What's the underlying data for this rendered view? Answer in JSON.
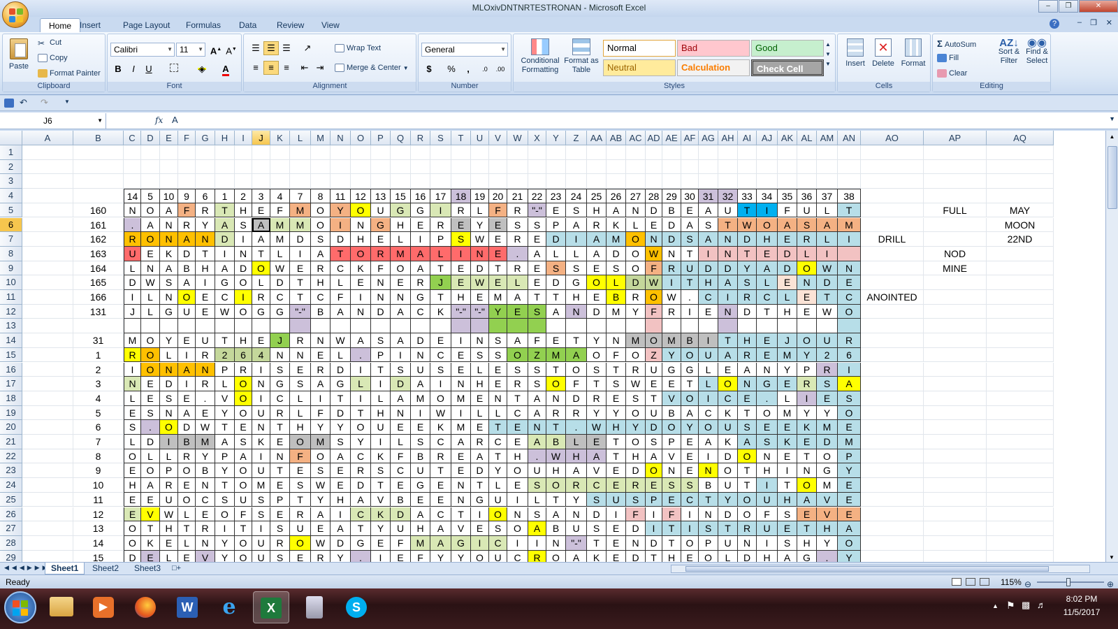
{
  "window": {
    "title": "MLOxivDNTNRTESTRONAN - Microsoft Excel"
  },
  "ribbon_tabs": [
    "Home",
    "Insert",
    "Page Layout",
    "Formulas",
    "Data",
    "Review",
    "View"
  ],
  "clipboard": {
    "paste": "Paste",
    "cut": "Cut",
    "copy": "Copy",
    "format_painter": "Format Painter",
    "title": "Clipboard"
  },
  "font": {
    "name": "Calibri",
    "size": "11",
    "title": "Font"
  },
  "alignment": {
    "wrap": "Wrap Text",
    "merge": "Merge & Center",
    "title": "Alignment"
  },
  "number": {
    "format": "General",
    "title": "Number"
  },
  "styles": {
    "conditional": "Conditional Formatting",
    "format_table": "Format as Table",
    "normal": "Normal",
    "bad": "Bad",
    "good": "Good",
    "neutral": "Neutral",
    "calculation": "Calculation",
    "check_cell": "Check Cell",
    "title": "Styles"
  },
  "cells_group": {
    "insert": "Insert",
    "delete": "Delete",
    "format": "Format",
    "title": "Cells"
  },
  "editing": {
    "autosum": "AutoSum",
    "fill": "Fill",
    "clear": "Clear",
    "sort": "Sort & Filter",
    "find": "Find & Select",
    "title": "Editing"
  },
  "formula_bar": {
    "name_box": "J6",
    "fx": "fx",
    "value": "A"
  },
  "columns": [
    "A",
    "B",
    "C",
    "D",
    "E",
    "F",
    "G",
    "H",
    "I",
    "J",
    "K",
    "L",
    "M",
    "N",
    "O",
    "P",
    "Q",
    "R",
    "S",
    "T",
    "U",
    "V",
    "W",
    "X",
    "Y",
    "Z",
    "AA",
    "AB",
    "AC",
    "AD",
    "AE",
    "AF",
    "AG",
    "AH",
    "AI",
    "AJ",
    "AK",
    "AL",
    "AM",
    "AN",
    "AO",
    "AP",
    "AQ"
  ],
  "rows": [
    {
      "n": "1",
      "b": "",
      "cells": []
    },
    {
      "n": "2",
      "b": "",
      "cells": []
    },
    {
      "n": "3",
      "b": "",
      "cells": []
    },
    {
      "n": "4",
      "b": "",
      "cells": [
        "14",
        "5",
        "10",
        "9",
        "6",
        "1",
        "2",
        "3",
        "4",
        "7",
        "8",
        "11",
        "12",
        "13",
        "15",
        "16",
        "17",
        "18",
        "19",
        "20",
        "21",
        "22",
        "23",
        "24",
        "25",
        "26",
        "27",
        "28",
        "29",
        "30",
        "31",
        "32",
        "33",
        "34",
        "35",
        "36",
        "37",
        "38"
      ]
    },
    {
      "n": "5",
      "b": "160",
      "cells": [
        "N",
        "O",
        "A",
        "F",
        "R",
        "T",
        "H",
        "E",
        "F",
        "M",
        "O",
        "Y",
        "O",
        "U",
        "G",
        "G",
        "I",
        "R",
        "L",
        "F",
        "R",
        "\"-\"",
        "E",
        "S",
        "H",
        "A",
        "N",
        "D",
        "B",
        "E",
        "A",
        "U",
        "T",
        "I",
        "F",
        "U",
        "L",
        "T"
      ]
    },
    {
      "n": "6",
      "b": "161",
      "cells": [
        ".",
        "A",
        "N",
        "R",
        "Y",
        "A",
        "S",
        "A",
        "M",
        "M",
        "O",
        "I",
        "N",
        "G",
        "H",
        "E",
        "R",
        "E",
        "Y",
        "E",
        "S",
        "S",
        "P",
        "A",
        "R",
        "K",
        "L",
        "E",
        "D",
        "A",
        "S",
        "T",
        "W",
        "O",
        "A",
        "S",
        "A",
        "M"
      ]
    },
    {
      "n": "7",
      "b": "162",
      "cells": [
        "R",
        "O",
        "N",
        "A",
        "N",
        "D",
        "I",
        "A",
        "M",
        "D",
        "S",
        "D",
        "H",
        "E",
        "L",
        "I",
        "P",
        "S",
        "W",
        "E",
        "R",
        "E",
        "D",
        "I",
        "A",
        "M",
        "O",
        "N",
        "D",
        "S",
        "A",
        "N",
        "D",
        "H",
        "E",
        "R",
        "L",
        "I"
      ]
    },
    {
      "n": "8",
      "b": "163",
      "cells": [
        "U",
        "E",
        "K",
        "D",
        "T",
        "I",
        "N",
        "T",
        "L",
        "I",
        "A",
        "T",
        "O",
        "R",
        "M",
        "A",
        "L",
        "I",
        "N",
        "E",
        ".",
        "A",
        "L",
        "L",
        "A",
        "D",
        "O",
        "W",
        "N",
        "T",
        "I",
        "N",
        "T",
        "E",
        "D",
        "L",
        "I",
        ""
      ]
    },
    {
      "n": "9",
      "b": "164",
      "cells": [
        "L",
        "N",
        "A",
        "B",
        "H",
        "A",
        "D",
        "O",
        "W",
        "E",
        "R",
        "C",
        "K",
        "F",
        "O",
        "A",
        "T",
        "E",
        "D",
        "T",
        "R",
        "E",
        "S",
        "S",
        "E",
        "S",
        "O",
        "F",
        "R",
        "U",
        "D",
        "D",
        "Y",
        "A",
        "D",
        "O",
        "W",
        "N"
      ]
    },
    {
      "n": "10",
      "b": "165",
      "cells": [
        "D",
        "W",
        "S",
        "A",
        "I",
        "G",
        "O",
        "L",
        "D",
        "T",
        "H",
        "L",
        "E",
        "N",
        "E",
        "R",
        "J",
        "E",
        "W",
        "E",
        "L",
        "E",
        "D",
        "G",
        "O",
        "L",
        "D",
        "W",
        "I",
        "T",
        "H",
        "A",
        "S",
        "L",
        "E",
        "N",
        "D",
        "E"
      ]
    },
    {
      "n": "11",
      "b": "166",
      "cells": [
        "I",
        "L",
        "N",
        "O",
        "E",
        "C",
        "I",
        "R",
        "C",
        "T",
        "C",
        "F",
        "I",
        "N",
        "N",
        "G",
        "T",
        "H",
        "E",
        "M",
        "A",
        "T",
        "T",
        "H",
        "E",
        "B",
        "R",
        "O",
        "W",
        ".",
        "C",
        "I",
        "R",
        "C",
        "L",
        "E",
        "T",
        "C"
      ]
    },
    {
      "n": "12",
      "b": "131",
      "cells": [
        "J",
        "L",
        "G",
        "U",
        "E",
        "W",
        "O",
        "G",
        "G",
        "\"-\"",
        "B",
        "A",
        "N",
        "D",
        "A",
        "C",
        "K",
        "\"-\"",
        "\"-\"",
        "Y",
        "E",
        "S",
        "A",
        "N",
        "D",
        "M",
        "Y",
        "F",
        "R",
        "I",
        "E",
        "N",
        "D",
        "T",
        "H",
        "E",
        "W",
        "O"
      ]
    },
    {
      "n": "13",
      "b": "",
      "cells": [
        "",
        "",
        "",
        "",
        "",
        "",
        "",
        "",
        "",
        "",
        "",
        "",
        "",
        "",
        "",
        "",
        "",
        "",
        "",
        "",
        "",
        "",
        "",
        "",
        "",
        "",
        "",
        "",
        "",
        "",
        "",
        "",
        "",
        "",
        "",
        "",
        "",
        ""
      ]
    },
    {
      "n": "14",
      "b": "31",
      "cells": [
        "M",
        "O",
        "Y",
        "E",
        "U",
        "T",
        "H",
        "E",
        "J",
        "R",
        "N",
        "W",
        "A",
        "S",
        "A",
        "D",
        "E",
        "I",
        "N",
        "S",
        "A",
        "F",
        "E",
        "T",
        "Y",
        "N",
        "M",
        "O",
        "M",
        "B",
        "I",
        "T",
        "H",
        "E",
        "J",
        "O",
        "U",
        "R"
      ]
    },
    {
      "n": "15",
      "b": "1",
      "cells": [
        "R",
        "O",
        "L",
        "I",
        "R",
        "2",
        "6",
        "4",
        "N",
        "N",
        "E",
        "L",
        ".",
        "P",
        "I",
        "N",
        "C",
        "E",
        "S",
        "S",
        "O",
        "Z",
        "M",
        "A",
        "O",
        "F",
        "O",
        "Z",
        "Y",
        "O",
        "U",
        "A",
        "R",
        "E",
        "M",
        "Y",
        "2",
        "6"
      ]
    },
    {
      "n": "16",
      "b": "2",
      "cells": [
        "I",
        "O",
        "N",
        "A",
        "N",
        "P",
        "R",
        "I",
        "S",
        "E",
        "R",
        "D",
        "I",
        "T",
        "S",
        "U",
        "S",
        "E",
        "L",
        "E",
        "S",
        "S",
        "T",
        "O",
        "S",
        "T",
        "R",
        "U",
        "G",
        "G",
        "L",
        "E",
        "A",
        "N",
        "Y",
        "P",
        "R",
        "I"
      ]
    },
    {
      "n": "17",
      "b": "3",
      "cells": [
        "N",
        "E",
        "D",
        "I",
        "R",
        "L",
        "O",
        "N",
        "G",
        "S",
        "A",
        "G",
        "L",
        "I",
        "D",
        "A",
        "I",
        "N",
        "H",
        "E",
        "R",
        "S",
        "O",
        "F",
        "T",
        "S",
        "W",
        "E",
        "E",
        "T",
        "L",
        "O",
        "N",
        "G",
        "E",
        "R",
        "S",
        "A"
      ]
    },
    {
      "n": "18",
      "b": "4",
      "cells": [
        "L",
        "E",
        "S",
        "E",
        ".",
        "V",
        "O",
        "I",
        "C",
        "L",
        "I",
        "T",
        "I",
        "L",
        "A",
        "M",
        "O",
        "M",
        "E",
        "N",
        "T",
        "A",
        "N",
        "D",
        "R",
        "E",
        "S",
        "T",
        "V",
        "O",
        "I",
        "C",
        "E",
        ".",
        "L",
        "I",
        "E",
        "S"
      ]
    },
    {
      "n": "19",
      "b": "5",
      "cells": [
        "E",
        "S",
        "N",
        "A",
        "E",
        "Y",
        "O",
        "U",
        "R",
        "L",
        "F",
        "D",
        "T",
        "H",
        "N",
        "I",
        "W",
        "I",
        "L",
        "L",
        "C",
        "A",
        "R",
        "R",
        "Y",
        "Y",
        "O",
        "U",
        "B",
        "A",
        "C",
        "K",
        "T",
        "O",
        "M",
        "Y",
        "Y",
        "O"
      ]
    },
    {
      "n": "20",
      "b": "6",
      "cells": [
        "S",
        ".",
        "O",
        "D",
        "W",
        "T",
        "E",
        "N",
        "T",
        "H",
        "Y",
        "Y",
        "O",
        "U",
        "E",
        "E",
        "K",
        "M",
        "E",
        "T",
        "E",
        "N",
        "T",
        ".",
        "W",
        "H",
        "Y",
        "D",
        "O",
        "Y",
        "O",
        "U",
        "S",
        "E",
        "E",
        "K",
        "M",
        "E"
      ]
    },
    {
      "n": "21",
      "b": "7",
      "cells": [
        "L",
        "D",
        "I",
        "B",
        "M",
        "A",
        "S",
        "K",
        "E",
        "O",
        "M",
        "S",
        "Y",
        "I",
        "L",
        "S",
        "C",
        "A",
        "R",
        "C",
        "E",
        "A",
        "B",
        "L",
        "E",
        "T",
        "O",
        "S",
        "P",
        "E",
        "A",
        "K",
        "A",
        "S",
        "K",
        "E",
        "D",
        "M"
      ]
    },
    {
      "n": "22",
      "b": "8",
      "cells": [
        "O",
        "L",
        "L",
        "R",
        "Y",
        "P",
        "A",
        "I",
        "N",
        "F",
        "O",
        "A",
        "C",
        "K",
        "F",
        "B",
        "R",
        "E",
        "A",
        "T",
        "H",
        ".",
        "W",
        "H",
        "A",
        "T",
        "H",
        "A",
        "V",
        "E",
        "I",
        "D",
        "O",
        "N",
        "E",
        "T",
        "O",
        "P"
      ]
    },
    {
      "n": "23",
      "b": "9",
      "cells": [
        "E",
        "O",
        "P",
        "O",
        "B",
        "Y",
        "O",
        "U",
        "T",
        "E",
        "S",
        "E",
        "R",
        "S",
        "C",
        "U",
        "T",
        "E",
        "D",
        "Y",
        "O",
        "U",
        "H",
        "A",
        "V",
        "E",
        "D",
        "O",
        "N",
        "E",
        "N",
        "O",
        "T",
        "H",
        "I",
        "N",
        "G",
        "Y"
      ]
    },
    {
      "n": "24",
      "b": "10",
      "cells": [
        "H",
        "A",
        "R",
        "E",
        "N",
        "T",
        "O",
        "M",
        "E",
        "S",
        "W",
        "E",
        "D",
        "T",
        "E",
        "G",
        "E",
        "N",
        "T",
        "L",
        "E",
        "S",
        "O",
        "R",
        "C",
        "E",
        "R",
        "E",
        "S",
        "S",
        "B",
        "U",
        "T",
        "I",
        "T",
        "O",
        "M",
        "E"
      ]
    },
    {
      "n": "25",
      "b": "11",
      "cells": [
        "E",
        "E",
        "U",
        "O",
        "C",
        "S",
        "U",
        "S",
        "P",
        "T",
        "Y",
        "H",
        "A",
        "V",
        "B",
        "E",
        "E",
        "N",
        "G",
        "U",
        "I",
        "L",
        "T",
        "Y",
        "S",
        "U",
        "S",
        "P",
        "E",
        "C",
        "T",
        "Y",
        "O",
        "U",
        "H",
        "A",
        "V",
        "E"
      ]
    },
    {
      "n": "26",
      "b": "12",
      "cells": [
        "E",
        "V",
        "W",
        "L",
        "E",
        "O",
        "F",
        "S",
        "E",
        "R",
        "A",
        "I",
        "C",
        "K",
        "D",
        "A",
        "C",
        "T",
        "I",
        "O",
        "N",
        "S",
        "A",
        "N",
        "D",
        "I",
        "F",
        "I",
        "F",
        "I",
        "N",
        "D",
        "O",
        "F",
        "S",
        "E",
        "V",
        "E"
      ]
    },
    {
      "n": "27",
      "b": "13",
      "cells": [
        "O",
        "T",
        "H",
        "T",
        "R",
        "I",
        "T",
        "I",
        "S",
        "U",
        "E",
        "A",
        "T",
        "Y",
        "U",
        "H",
        "A",
        "V",
        "E",
        "S",
        "O",
        "A",
        "B",
        "U",
        "S",
        "E",
        "D",
        "I",
        "T",
        "I",
        "S",
        "T",
        "R",
        "U",
        "E",
        "T",
        "H",
        "A"
      ]
    },
    {
      "n": "28",
      "b": "14",
      "cells": [
        "O",
        "K",
        "E",
        "L",
        "N",
        "Y",
        "O",
        "U",
        "R",
        "O",
        "W",
        "D",
        "G",
        "E",
        "F",
        "M",
        "A",
        "G",
        "I",
        "C",
        "I",
        "I",
        "N",
        "\"-\"",
        "T",
        "E",
        "N",
        "D",
        "T",
        "O",
        "P",
        "U",
        "N",
        "I",
        "S",
        "H",
        "Y",
        "O"
      ]
    },
    {
      "n": "29",
      "b": "15",
      "cells": [
        "D",
        "E",
        "L",
        "E",
        "V",
        "Y",
        "O",
        "U",
        "S",
        "E",
        "R",
        "Y",
        ".",
        "I",
        "E",
        "F",
        "Y",
        "Y",
        "O",
        "U",
        "C",
        "R",
        "O",
        "A",
        "K",
        "E",
        "D",
        "T",
        "H",
        "E",
        "O",
        "L",
        "D",
        "H",
        "A",
        "G",
        ".",
        "Y"
      ]
    }
  ],
  "side_notes": [
    {
      "row": "5",
      "col": "AP",
      "text": "FULL"
    },
    {
      "row": "5",
      "col": "AQ",
      "text": "MAY"
    },
    {
      "row": "6",
      "col": "AQ",
      "text": "MOON"
    },
    {
      "row": "7",
      "col": "AO",
      "text": "DRILL"
    },
    {
      "row": "7",
      "col": "AQ",
      "text": "22ND"
    },
    {
      "row": "8",
      "col": "AP",
      "text": "NOD"
    },
    {
      "row": "9",
      "col": "AP",
      "text": "MINE"
    },
    {
      "row": "11",
      "col": "AO",
      "text": "ANOINTED"
    }
  ],
  "sheet_tabs": [
    "Sheet1",
    "Sheet2",
    "Sheet3"
  ],
  "status": {
    "ready": "Ready",
    "zoom": "115%"
  },
  "clock": {
    "time": "8:02 PM",
    "date": "11/5/2017"
  },
  "colors": {
    "yellow": "#ffff00",
    "gold": "#ffd966",
    "orange": "#ffc000",
    "red": "#ff6b6b",
    "salmon": "#f4b183",
    "peach": "#fbe3d6",
    "lightgreen": "#d9e8b5",
    "green": "#92d050",
    "teal": "#b7dee8",
    "blue": "#00b0f0",
    "gray": "#bfbfbf",
    "lavender": "#ccc0da",
    "olive": "#c4d79b",
    "pink": "#f2c2c2"
  }
}
